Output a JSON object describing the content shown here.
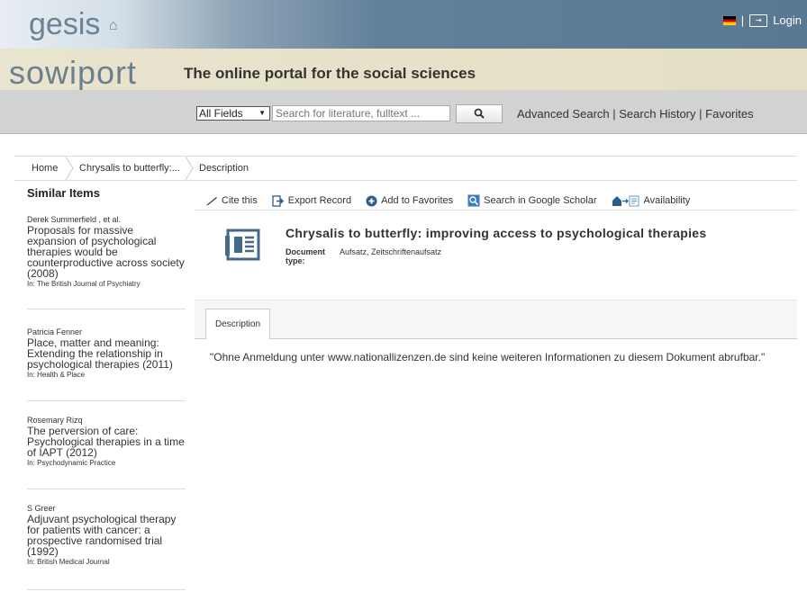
{
  "header": {
    "gesis_logo": "gesis",
    "login_label": "Login"
  },
  "brand": {
    "logo": "sowiport",
    "tagline": "The online portal for the social sciences"
  },
  "search": {
    "field_selected": "All Fields",
    "placeholder": "Search for literature, fulltext ...",
    "links": {
      "advanced": "Advanced Search",
      "history": "Search History",
      "favorites": "Favorites",
      "sep": "|"
    }
  },
  "breadcrumb": {
    "home": "Home",
    "item": "Chrysalis to butterfly:...",
    "current": "Description"
  },
  "sidebar": {
    "title": "Similar Items",
    "items": [
      {
        "author": "Derek Summerfield , et al.",
        "title": "Proposals for massive expansion of psychological therapies would be counterproductive across society (2008)",
        "source": "In: The British Journal of Psychiatry"
      },
      {
        "author": "Patricia Fenner",
        "title": "Place, matter and meaning: Extending the relationship in psychological therapies (2011)",
        "source": "In: Health & Place"
      },
      {
        "author": "Rosemary Rizq",
        "title": "The perversion of care: Psychological therapies in a time of IAPT (2012)",
        "source": "In: Psychodynamic Practice"
      },
      {
        "author": "S Greer",
        "title": "Adjuvant psychological therapy for patients with cancer: a prospective randomised trial (1992)",
        "source": "In: British Medical Journal"
      }
    ]
  },
  "actions": {
    "cite": "Cite this",
    "export": "Export Record",
    "favorites": "Add to Favorites",
    "scholar": "Search in Google Scholar",
    "availability": "Availability"
  },
  "record": {
    "title": "Chrysalis to butterfly: improving access to psychological therapies",
    "type_label": "Document type:",
    "type_value": "Aufsatz, Zeitschriftenaufsatz"
  },
  "tabs": {
    "description": "Description"
  },
  "description_text": "\"Ohne Anmeldung unter www.nationallizenzen.de sind keine weiteren Informationen zu diesem Dokument abrufbar.\"",
  "colors": {
    "header_blue": "#5a7892",
    "brand_beige": "#e6e1c8",
    "search_gray": "#d2d2d2"
  }
}
